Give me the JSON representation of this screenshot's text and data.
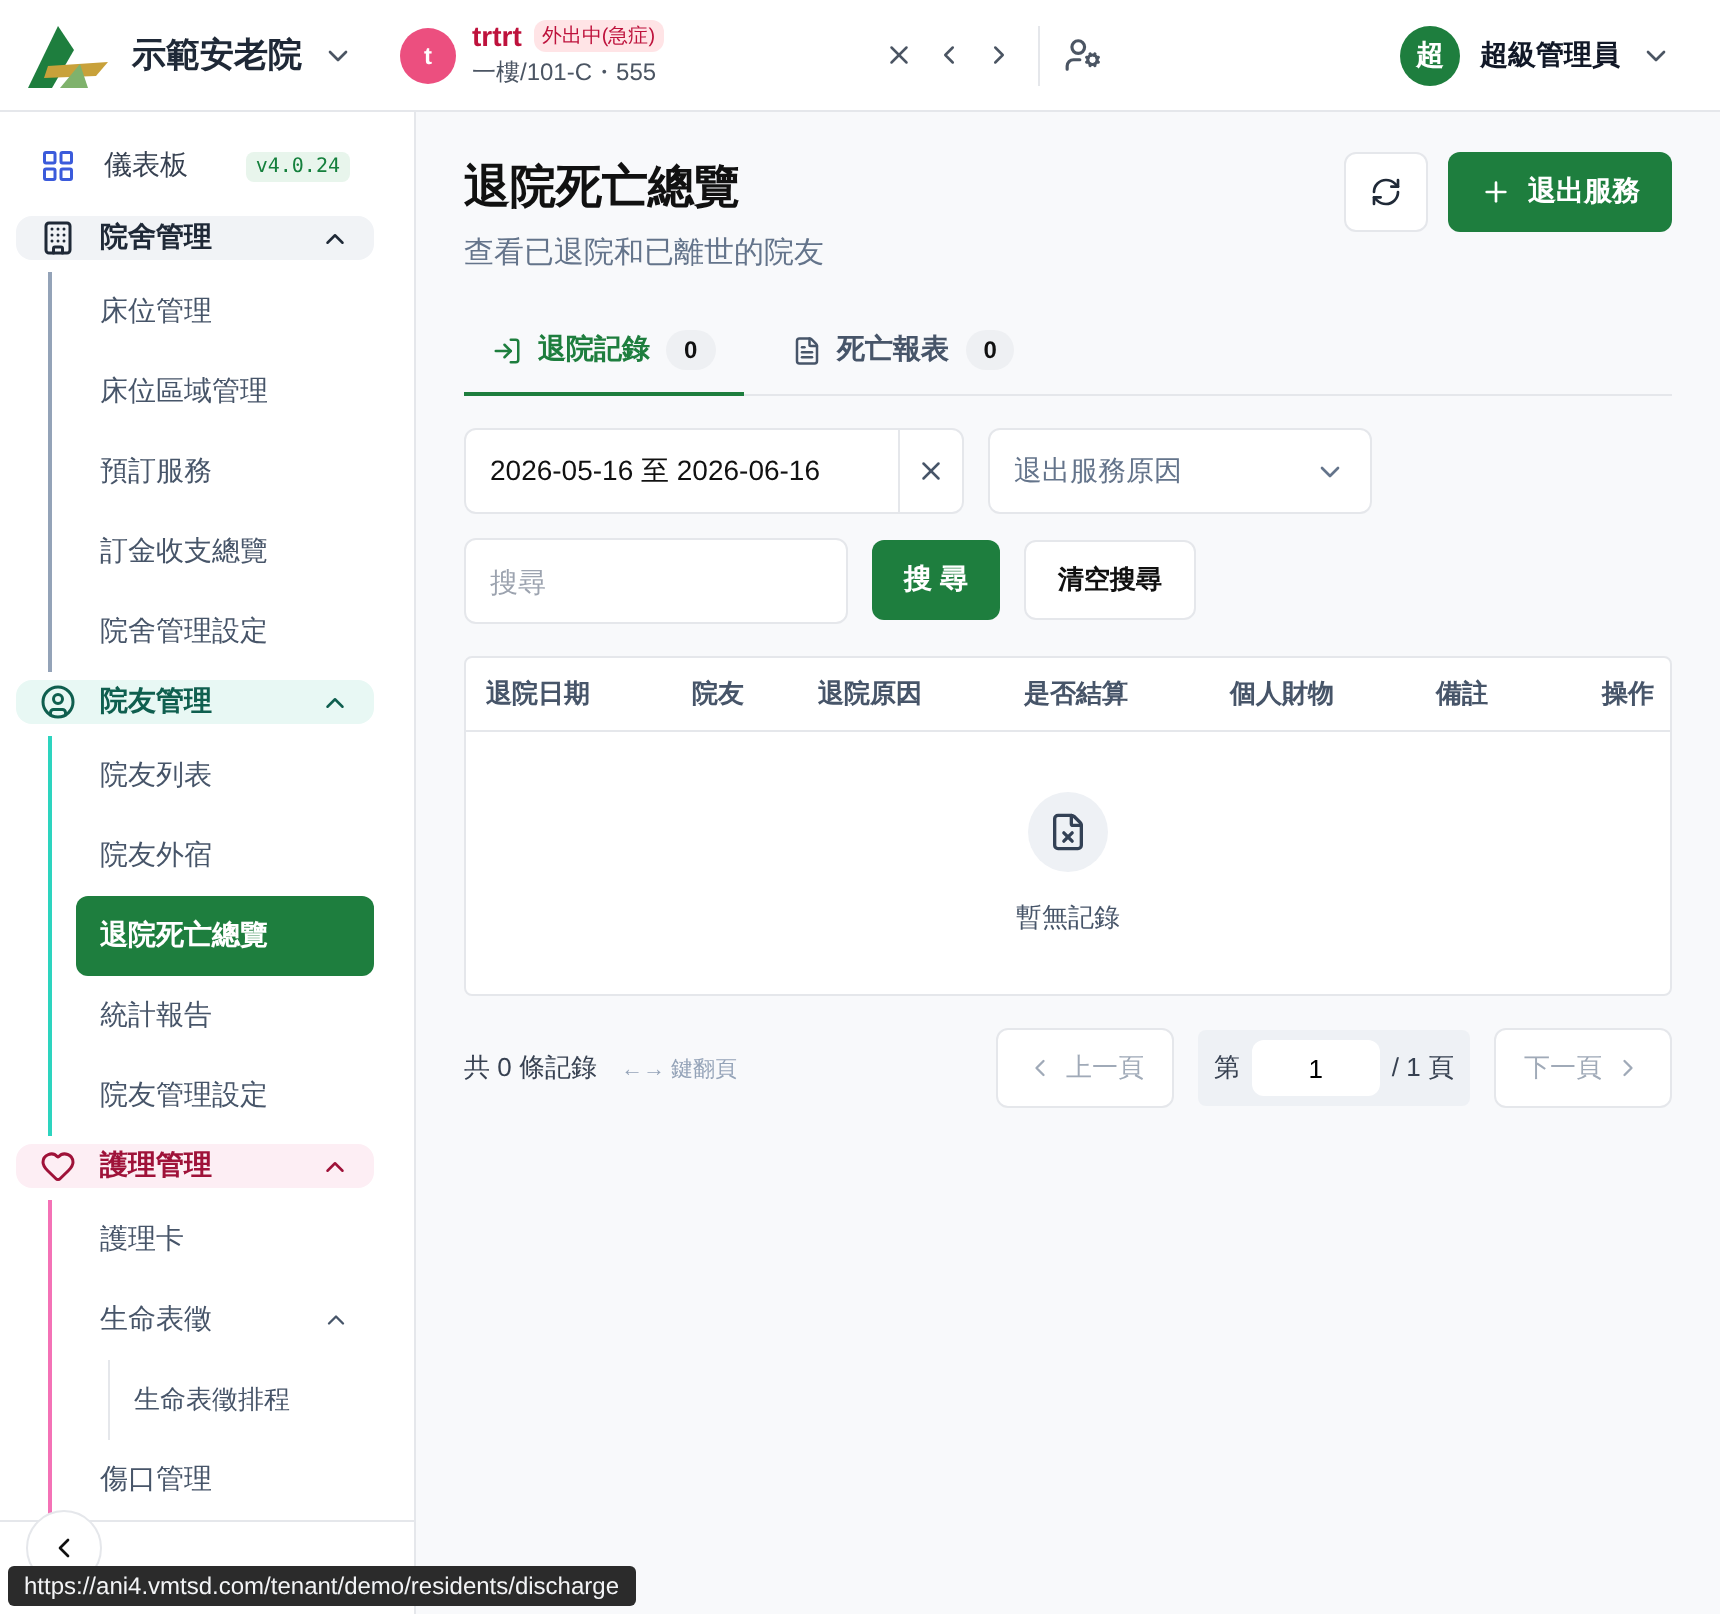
{
  "header": {
    "org_name": "示範安老院",
    "resident": {
      "avatar_letter": "t",
      "name": "trtrt",
      "badge": "外出中(急症)",
      "location": "一樓/101-C・555"
    },
    "user": {
      "avatar_letter": "超",
      "name": "超級管理員"
    }
  },
  "sidebar": {
    "dashboard": {
      "label": "儀表板",
      "version": "v4.0.24"
    },
    "groups": [
      {
        "label": "院舍管理",
        "kind": "building",
        "color": "#94a3b8",
        "expanded": true,
        "children": [
          {
            "label": "床位管理",
            "selected": false
          },
          {
            "label": "床位區域管理",
            "selected": false
          },
          {
            "label": "預訂服務",
            "selected": false
          },
          {
            "label": "訂金收支總覽",
            "selected": false
          },
          {
            "label": "院舍管理設定",
            "selected": false
          }
        ]
      },
      {
        "label": "院友管理",
        "kind": "person",
        "color": "#2dd4bf",
        "expanded": true,
        "children": [
          {
            "label": "院友列表",
            "selected": false
          },
          {
            "label": "院友外宿",
            "selected": false
          },
          {
            "label": "退院死亡總覽",
            "selected": true
          },
          {
            "label": "統計報告",
            "selected": false
          },
          {
            "label": "院友管理設定",
            "selected": false
          }
        ]
      },
      {
        "label": "護理管理",
        "kind": "heart",
        "color": "#f472b6",
        "expanded": true,
        "children": [
          {
            "label": "護理卡",
            "selected": false
          },
          {
            "label": "生命表徵",
            "selected": false,
            "expanded": true,
            "children": [
              {
                "label": "生命表徵排程",
                "selected": false
              }
            ]
          },
          {
            "label": "傷口管理",
            "selected": false
          }
        ]
      }
    ]
  },
  "page": {
    "title": "退院死亡總覽",
    "subtitle": "查看已退院和已離世的院友",
    "add_button": "退出服務",
    "tabs": [
      {
        "label": "退院記錄",
        "count": "0",
        "kind": "exit",
        "selected": true
      },
      {
        "label": "死亡報表",
        "count": "0",
        "kind": "document",
        "selected": false
      }
    ],
    "date_range": "2026-05-16 至 2026-06-16",
    "reason_select": {
      "placeholder": "退出服務原因"
    },
    "search": {
      "placeholder": "搜尋"
    },
    "search_button": "搜 尋",
    "clear_button": "清空搜尋",
    "table": {
      "columns": [
        "退院日期",
        "院友",
        "退院原因",
        "是否結算",
        "個人財物",
        "備註",
        "操作"
      ],
      "empty_text": "暫無記錄"
    },
    "pagination": {
      "total": "共 0 條記錄",
      "hint": "←→ 鍵翻頁",
      "prev": "上一頁",
      "prev_disabled": true,
      "page_prefix": "第",
      "page_value": "1",
      "page_suffix": "/ 1 頁",
      "next": "下一頁",
      "next_disabled": true
    }
  },
  "status_bar": {
    "url": "https://ani4.vmtsd.com/tenant/demo/residents/discharge"
  }
}
